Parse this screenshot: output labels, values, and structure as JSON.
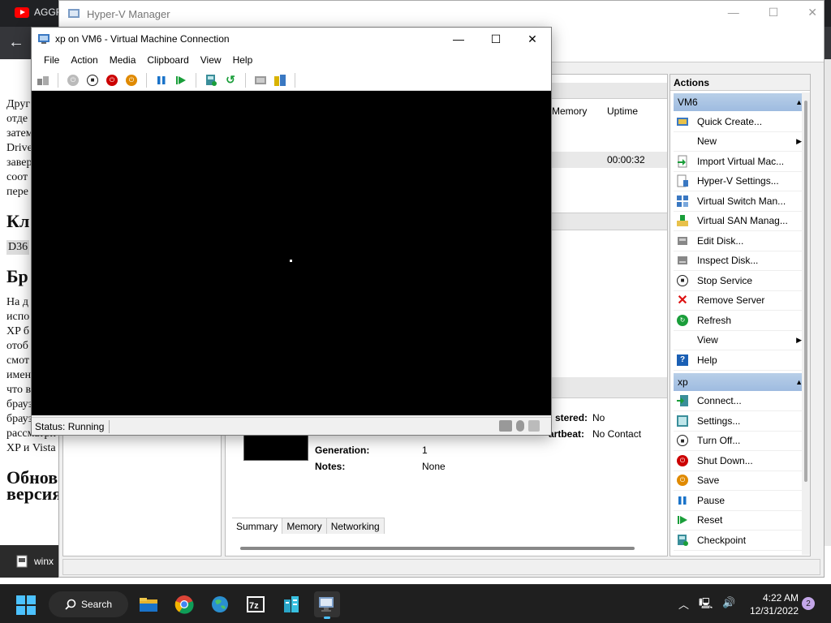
{
  "browser": {
    "tab_label": "AGGR",
    "article": {
      "para1": [
        "Друг",
        "отде",
        "затем",
        "Drive",
        "завер",
        "соот",
        "пере"
      ],
      "heading1": "Кл",
      "code": "D36",
      "heading2": "Бр",
      "para2": [
        "На д",
        "испо",
        "XP б",
        "отоб",
        "смот",
        "имен",
        "что в",
        "браузера",
        "браузера,",
        "рассматри",
        "XP и Vista"
      ],
      "heading3": "Обнов",
      "heading3b": "версия"
    }
  },
  "hyperv": {
    "title": "Hyper-V Manager",
    "columns": {
      "memory": "Memory",
      "uptime": "Uptime"
    },
    "vm_row": {
      "uptime": "00:00:32"
    },
    "details": {
      "generation_label": "Generation:",
      "generation_value": "1",
      "notes_label": "Notes:",
      "notes_value": "None",
      "clustered_label": "stered:",
      "clustered_value": "No",
      "heartbeat_label": "artbeat:",
      "heartbeat_value": "No Contact"
    },
    "tabs": [
      "Summary",
      "Memory",
      "Networking"
    ],
    "actions": {
      "title": "Actions",
      "group1": "VM6",
      "group1_items": [
        {
          "label": "Quick Create...",
          "icon": "quick-create-icon"
        },
        {
          "label": "New",
          "icon": "none",
          "submenu": true
        },
        {
          "label": "Import Virtual Mac...",
          "icon": "import-icon"
        },
        {
          "label": "Hyper-V Settings...",
          "icon": "settings-icon"
        },
        {
          "label": "Virtual Switch Man...",
          "icon": "switch-icon"
        },
        {
          "label": "Virtual SAN Manag...",
          "icon": "san-icon"
        },
        {
          "label": "Edit Disk...",
          "icon": "edit-disk-icon"
        },
        {
          "label": "Inspect Disk...",
          "icon": "inspect-disk-icon"
        },
        {
          "label": "Stop Service",
          "icon": "stop-icon"
        },
        {
          "label": "Remove Server",
          "icon": "remove-icon"
        },
        {
          "label": "Refresh",
          "icon": "refresh-icon"
        },
        {
          "label": "View",
          "icon": "none",
          "submenu": true
        },
        {
          "label": "Help",
          "icon": "help-icon"
        }
      ],
      "group2": "xp",
      "group2_items": [
        {
          "label": "Connect...",
          "icon": "connect-icon"
        },
        {
          "label": "Settings...",
          "icon": "vm-settings-icon"
        },
        {
          "label": "Turn Off...",
          "icon": "turn-off-icon"
        },
        {
          "label": "Shut Down...",
          "icon": "shut-down-icon"
        },
        {
          "label": "Save",
          "icon": "save-icon"
        },
        {
          "label": "Pause",
          "icon": "pause-icon"
        },
        {
          "label": "Reset",
          "icon": "reset-icon"
        },
        {
          "label": "Checkpoint",
          "icon": "checkpoint-icon"
        }
      ]
    }
  },
  "vmconnect": {
    "title": "xp on VM6 - Virtual Machine Connection",
    "menu": [
      "File",
      "Action",
      "Media",
      "Clipboard",
      "View",
      "Help"
    ],
    "status": "Status: Running"
  },
  "taskbar": {
    "task_thumb_label": "winx",
    "search_label": "Search",
    "time": "4:22 AM",
    "date": "12/31/2022",
    "notifications": "2",
    "accent": "#4cc2ff"
  }
}
